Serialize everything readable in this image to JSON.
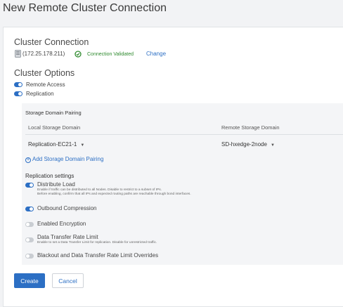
{
  "page": {
    "title": "New Remote Cluster Connection"
  },
  "cluster_connection": {
    "heading": "Cluster Connection",
    "ip": "(172.25.178.211)",
    "status": "Connection Validated",
    "change_label": "Change",
    "status_color": "#2f8a2f"
  },
  "cluster_options": {
    "heading": "Cluster Options",
    "remote_access": {
      "label": "Remote Access",
      "enabled": true
    },
    "replication": {
      "label": "Replication",
      "enabled": true
    }
  },
  "storage_pairing": {
    "title": "Storage Domain Pairing",
    "local_header": "Local Storage Domain",
    "remote_header": "Remote Storage Domain",
    "local_value": "Replication-EC21-1",
    "remote_value": "SD-hxedge-2node",
    "add_label": "Add Storage Domain Pairing"
  },
  "replication_settings": {
    "title": "Replication settings",
    "distribute_load": {
      "label": "Distribute Load",
      "enabled": true,
      "desc1": "Enable if traffic can be distributed to all Nodes. Disable to restrict to a subset of IPs.",
      "desc2": "Before enabling, confirm that all IPs and expected routing paths are reachable through bond interfaces."
    },
    "outbound_compression": {
      "label": "Outbound Compression",
      "enabled": true
    },
    "encryption": {
      "label": "Enabled Encryption",
      "enabled": false
    },
    "rate_limit": {
      "label": "Data Transfer Rate Limit",
      "enabled": false,
      "desc": "Enable to set a Data Transfer Limit for replication. Disable for unrestricted traffic."
    },
    "blackout": {
      "label": "Blackout and Data Transfer Rate Limit Overrides",
      "enabled": false
    }
  },
  "actions": {
    "create_label": "Create",
    "cancel_label": "Cancel"
  },
  "colors": {
    "accent": "#2c6fc4",
    "toggle_off": "#c9cdd2"
  }
}
